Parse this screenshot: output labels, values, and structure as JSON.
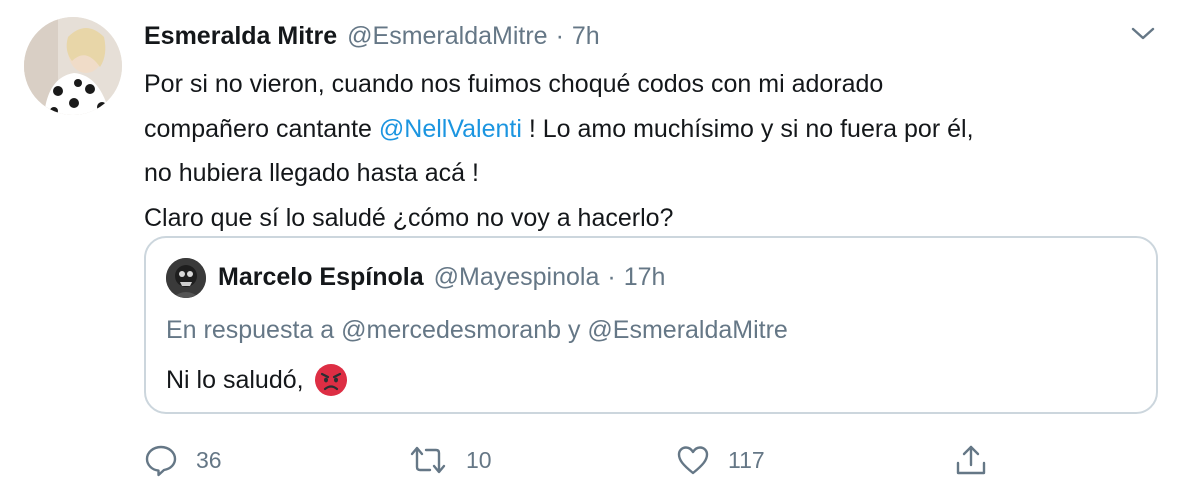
{
  "author": {
    "name": "Esmeralda Mitre",
    "handle": "@EsmeraldaMitre",
    "separator": "·",
    "time": "7h"
  },
  "tweet": {
    "line1": "Por si no vieron, cuando nos fuimos choqué codos con mi adorado",
    "line2_before": "compañero cantante ",
    "line2_mention": "@NellValenti",
    "line2_after": " ! Lo amo muchísimo y si no fuera por él,",
    "line3": "no hubiera llegado hasta acá !",
    "line4": "Claro que sí lo saludé ¿cómo no voy a hacerlo?"
  },
  "quoted": {
    "name": "Marcelo Espínola",
    "handle": "@Mayespinola",
    "separator": "·",
    "time": "17h",
    "replying": "En respuesta a @mercedesmoranb y @EsmeraldaMitre",
    "text": "Ni lo saludó,"
  },
  "actions": {
    "reply_count": "36",
    "retweet_count": "10",
    "like_count": "117"
  },
  "colors": {
    "link": "#1b95e0",
    "secondary_text": "#657786",
    "border": "#ccd6dd"
  }
}
